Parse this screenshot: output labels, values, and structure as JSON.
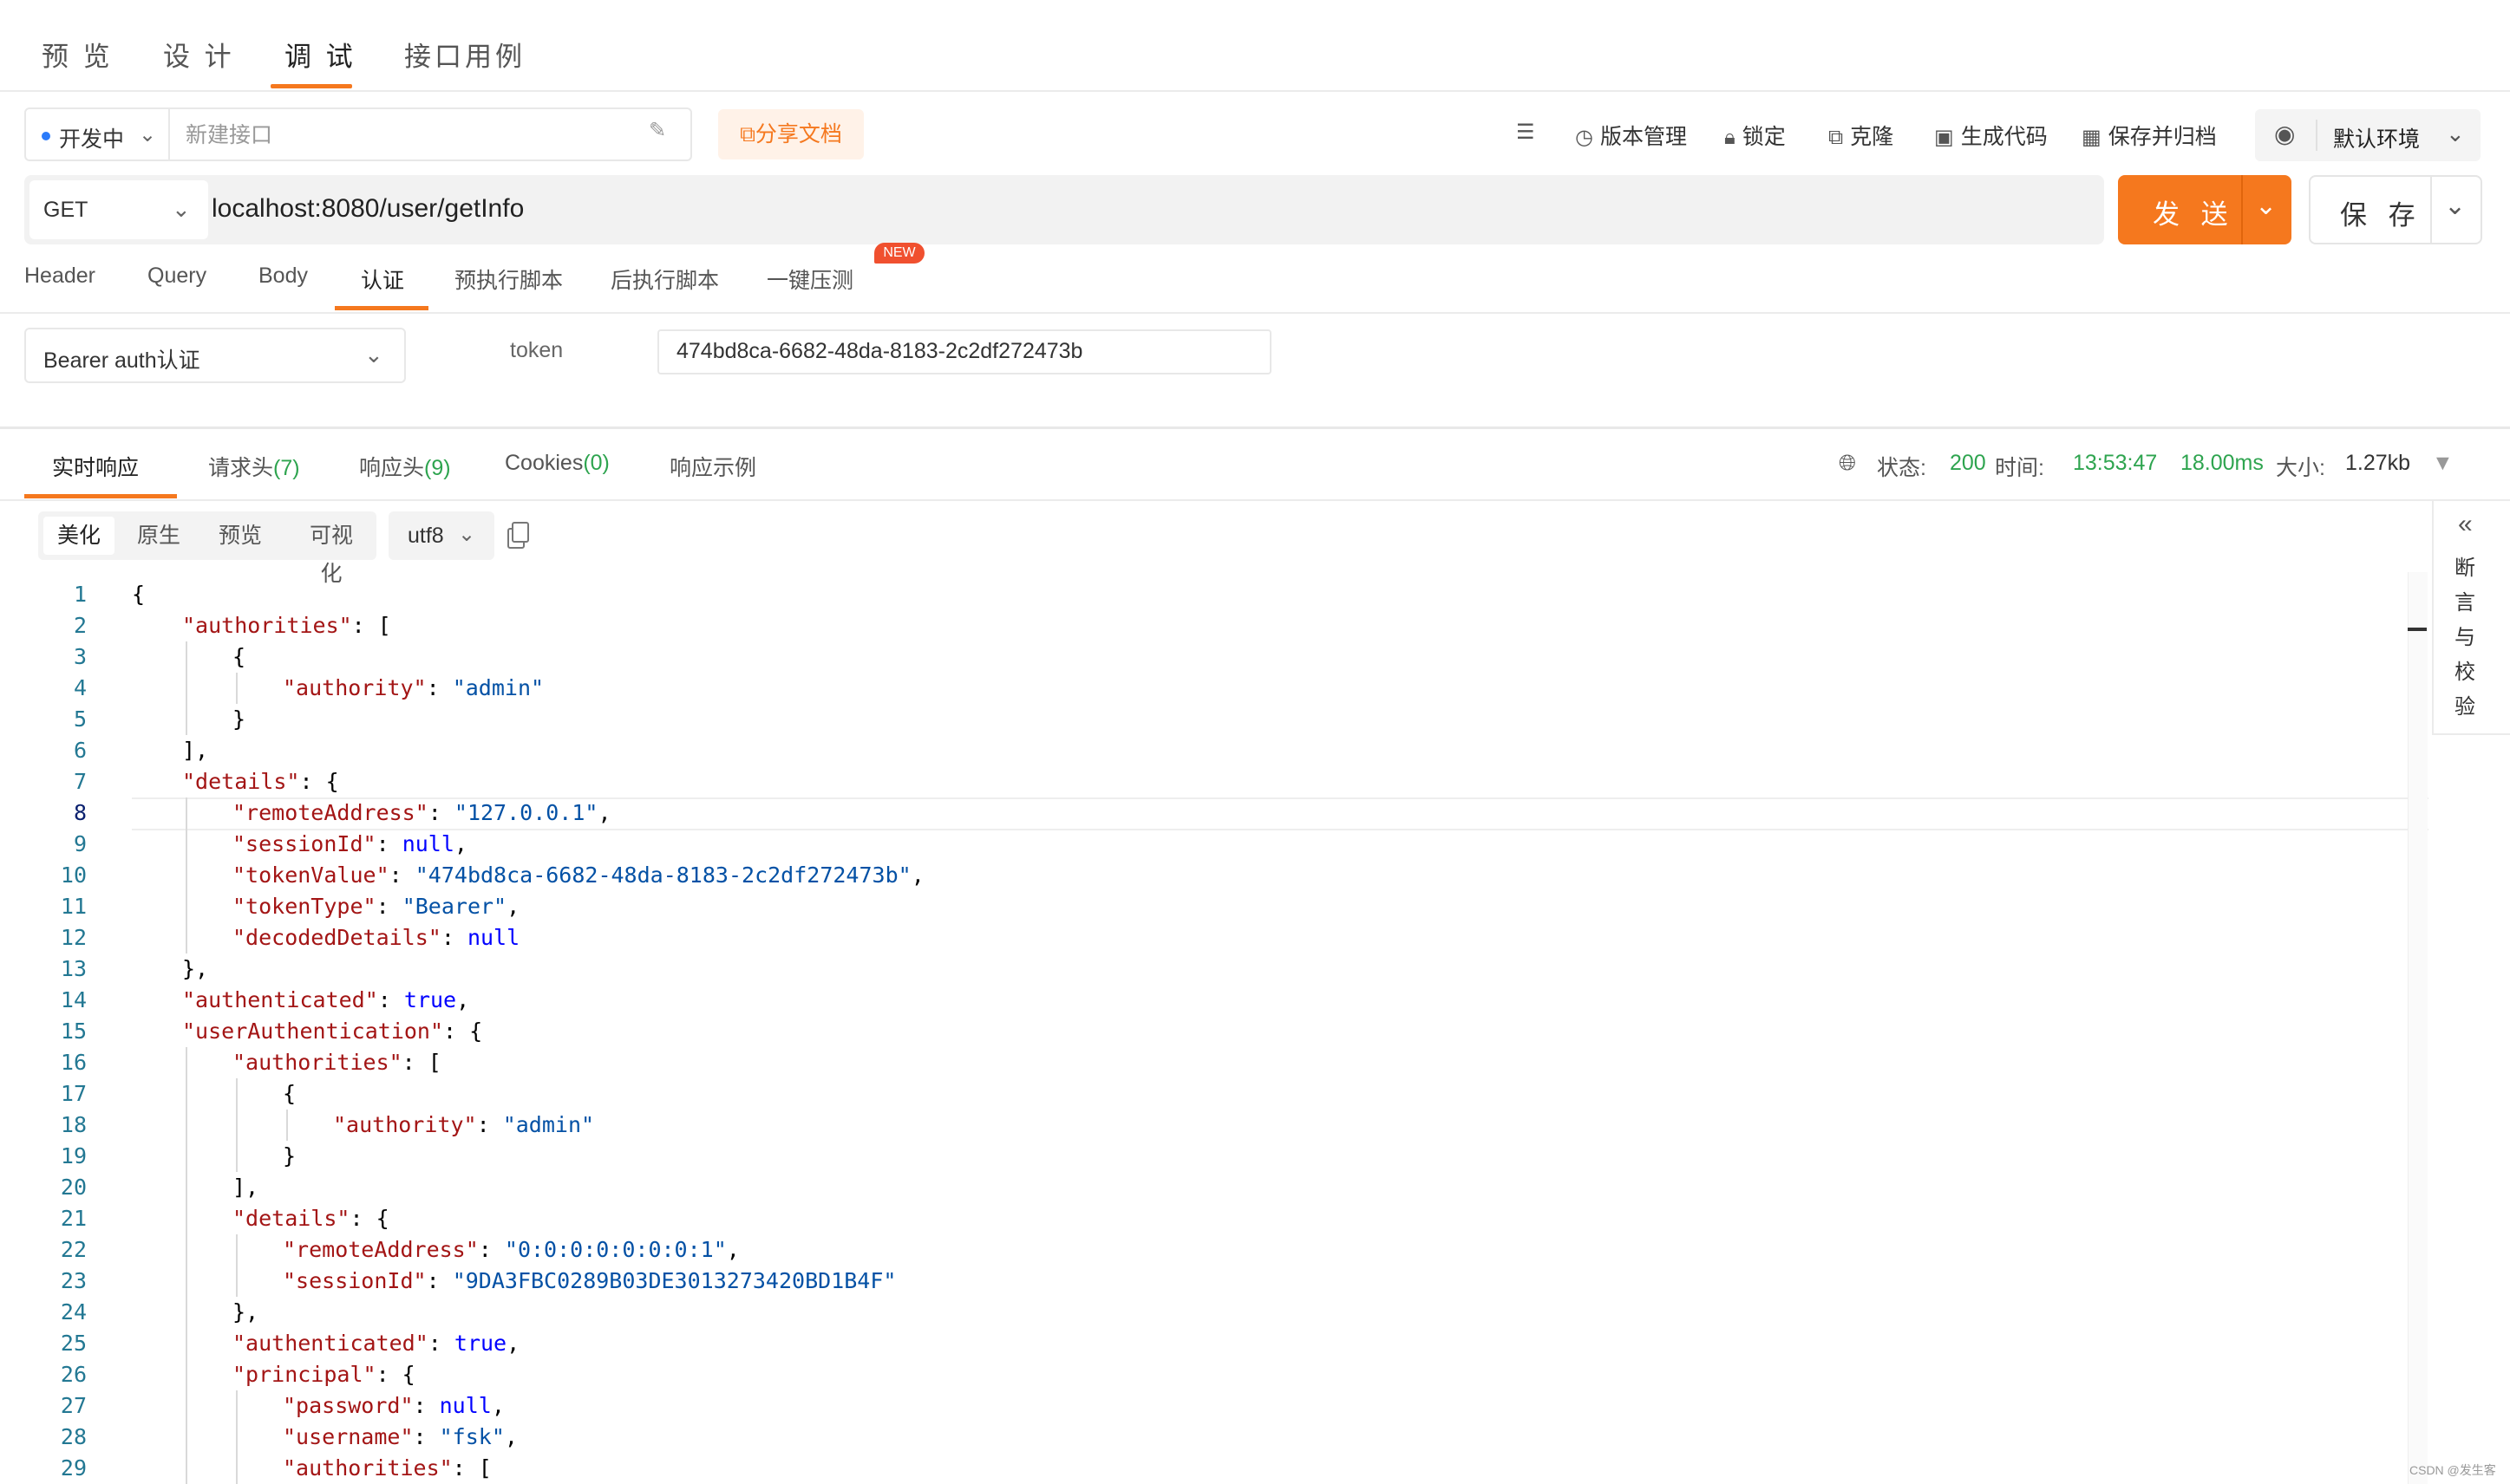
{
  "top_tabs": [
    "预 览",
    "设 计",
    "调 试",
    "接口用例"
  ],
  "status": {
    "label": "开发中",
    "name_placeholder": "新建接口"
  },
  "share_label": "分享文档",
  "tools": [
    "版本管理",
    "锁定",
    "克隆",
    "生成代码",
    "保存并归档"
  ],
  "environment": "默认环境",
  "request": {
    "method": "GET",
    "url": "localhost:8080/user/getInfo",
    "send_label": "发 送",
    "save_label": "保 存"
  },
  "req_tabs": [
    "Header",
    "Query",
    "Body",
    "认证",
    "预执行脚本",
    "后执行脚本",
    "一键压测"
  ],
  "new_badge": "NEW",
  "auth": {
    "type": "Bearer auth认证",
    "token_label": "token",
    "token_value": "474bd8ca-6682-48da-8183-2c2df272473b"
  },
  "resp_tabs": [
    {
      "label": "实时响应",
      "count": ""
    },
    {
      "label": "请求头",
      "count": "(7)"
    },
    {
      "label": "响应头",
      "count": "(9)"
    },
    {
      "label": "Cookies",
      "count": "(0)"
    },
    {
      "label": "响应示例",
      "count": ""
    }
  ],
  "resp_meta": {
    "status_label": "状态:",
    "status": "200",
    "time_label": "时间:",
    "time": "13:53:47",
    "duration": "18.00ms",
    "size_label": "大小:",
    "size": "1.27kb"
  },
  "view_modes": [
    "美化",
    "原生",
    "预览",
    "可视化"
  ],
  "encoding": "utf8",
  "side_panel": "断言与校验",
  "watermark": "CSDN @发生客",
  "colors": {
    "accent": "#f5781e",
    "success": "#2ea44f",
    "key": "#a31515",
    "string": "#0451a5",
    "keyword": "#0000ff"
  },
  "code_lines": [
    {
      "n": 1,
      "indent": 0,
      "parts": [
        [
          "p",
          "{"
        ]
      ]
    },
    {
      "n": 2,
      "indent": 1,
      "parts": [
        [
          "k",
          "\"authorities\""
        ],
        [
          "p",
          ": ["
        ]
      ]
    },
    {
      "n": 3,
      "indent": 2,
      "parts": [
        [
          "p",
          "{"
        ]
      ]
    },
    {
      "n": 4,
      "indent": 3,
      "parts": [
        [
          "k",
          "\"authority\""
        ],
        [
          "p",
          ": "
        ],
        [
          "s",
          "\"admin\""
        ]
      ]
    },
    {
      "n": 5,
      "indent": 2,
      "parts": [
        [
          "p",
          "}"
        ]
      ]
    },
    {
      "n": 6,
      "indent": 1,
      "parts": [
        [
          "p",
          "],"
        ]
      ]
    },
    {
      "n": 7,
      "indent": 1,
      "parts": [
        [
          "k",
          "\"details\""
        ],
        [
          "p",
          ": {"
        ]
      ]
    },
    {
      "n": 8,
      "indent": 2,
      "parts": [
        [
          "k",
          "\"remoteAddress\""
        ],
        [
          "p",
          ": "
        ],
        [
          "s",
          "\"127.0.0.1\""
        ],
        [
          "p",
          ","
        ]
      ]
    },
    {
      "n": 9,
      "indent": 2,
      "parts": [
        [
          "k",
          "\"sessionId\""
        ],
        [
          "p",
          ": "
        ],
        [
          "b",
          "null"
        ],
        [
          "p",
          ","
        ]
      ]
    },
    {
      "n": 10,
      "indent": 2,
      "parts": [
        [
          "k",
          "\"tokenValue\""
        ],
        [
          "p",
          ": "
        ],
        [
          "s",
          "\"474bd8ca-6682-48da-8183-2c2df272473b\""
        ],
        [
          "p",
          ","
        ]
      ]
    },
    {
      "n": 11,
      "indent": 2,
      "parts": [
        [
          "k",
          "\"tokenType\""
        ],
        [
          "p",
          ": "
        ],
        [
          "s",
          "\"Bearer\""
        ],
        [
          "p",
          ","
        ]
      ]
    },
    {
      "n": 12,
      "indent": 2,
      "parts": [
        [
          "k",
          "\"decodedDetails\""
        ],
        [
          "p",
          ": "
        ],
        [
          "b",
          "null"
        ]
      ]
    },
    {
      "n": 13,
      "indent": 1,
      "parts": [
        [
          "p",
          "},"
        ]
      ]
    },
    {
      "n": 14,
      "indent": 1,
      "parts": [
        [
          "k",
          "\"authenticated\""
        ],
        [
          "p",
          ": "
        ],
        [
          "b",
          "true"
        ],
        [
          "p",
          ","
        ]
      ]
    },
    {
      "n": 15,
      "indent": 1,
      "parts": [
        [
          "k",
          "\"userAuthentication\""
        ],
        [
          "p",
          ": {"
        ]
      ]
    },
    {
      "n": 16,
      "indent": 2,
      "parts": [
        [
          "k",
          "\"authorities\""
        ],
        [
          "p",
          ": ["
        ]
      ]
    },
    {
      "n": 17,
      "indent": 3,
      "parts": [
        [
          "p",
          "{"
        ]
      ]
    },
    {
      "n": 18,
      "indent": 4,
      "parts": [
        [
          "k",
          "\"authority\""
        ],
        [
          "p",
          ": "
        ],
        [
          "s",
          "\"admin\""
        ]
      ]
    },
    {
      "n": 19,
      "indent": 3,
      "parts": [
        [
          "p",
          "}"
        ]
      ]
    },
    {
      "n": 20,
      "indent": 2,
      "parts": [
        [
          "p",
          "],"
        ]
      ]
    },
    {
      "n": 21,
      "indent": 2,
      "parts": [
        [
          "k",
          "\"details\""
        ],
        [
          "p",
          ": {"
        ]
      ]
    },
    {
      "n": 22,
      "indent": 3,
      "parts": [
        [
          "k",
          "\"remoteAddress\""
        ],
        [
          "p",
          ": "
        ],
        [
          "s",
          "\"0:0:0:0:0:0:0:1\""
        ],
        [
          "p",
          ","
        ]
      ]
    },
    {
      "n": 23,
      "indent": 3,
      "parts": [
        [
          "k",
          "\"sessionId\""
        ],
        [
          "p",
          ": "
        ],
        [
          "s",
          "\"9DA3FBC0289B03DE3013273420BD1B4F\""
        ]
      ]
    },
    {
      "n": 24,
      "indent": 2,
      "parts": [
        [
          "p",
          "},"
        ]
      ]
    },
    {
      "n": 25,
      "indent": 2,
      "parts": [
        [
          "k",
          "\"authenticated\""
        ],
        [
          "p",
          ": "
        ],
        [
          "b",
          "true"
        ],
        [
          "p",
          ","
        ]
      ]
    },
    {
      "n": 26,
      "indent": 2,
      "parts": [
        [
          "k",
          "\"principal\""
        ],
        [
          "p",
          ": {"
        ]
      ]
    },
    {
      "n": 27,
      "indent": 3,
      "parts": [
        [
          "k",
          "\"password\""
        ],
        [
          "p",
          ": "
        ],
        [
          "b",
          "null"
        ],
        [
          "p",
          ","
        ]
      ]
    },
    {
      "n": 28,
      "indent": 3,
      "parts": [
        [
          "k",
          "\"username\""
        ],
        [
          "p",
          ": "
        ],
        [
          "s",
          "\"fsk\""
        ],
        [
          "p",
          ","
        ]
      ]
    },
    {
      "n": 29,
      "indent": 3,
      "parts": [
        [
          "k",
          "\"authorities\""
        ],
        [
          "p",
          ": ["
        ]
      ]
    }
  ],
  "current_line": 8
}
